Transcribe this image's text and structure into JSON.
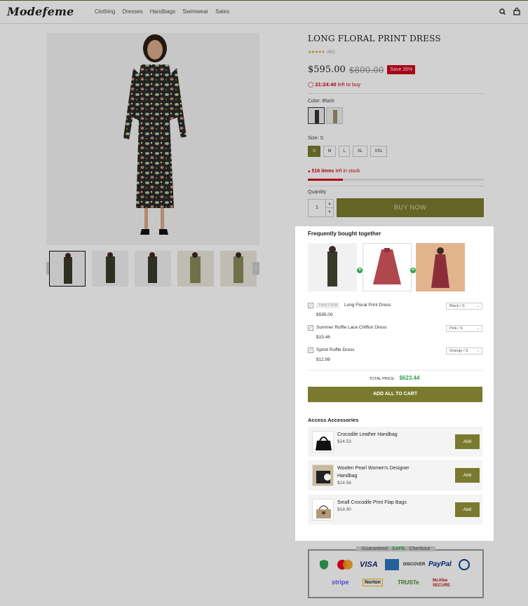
{
  "brand": {
    "logo_text": "Modefeme"
  },
  "nav": {
    "items": [
      "Clothing",
      "Dresses",
      "Handbags",
      "Swimwear",
      "Sales"
    ]
  },
  "product": {
    "title": "LONG FLORAL PRINT DRESS",
    "stars": "★★★★★",
    "review_count": "(60)",
    "price": "$595.00",
    "old_price": "$800.00",
    "save_badge": "Save 26%",
    "timer_time": "21:24:40",
    "timer_suffix": "left to buy",
    "color_label": "Color: Black",
    "size_label": "Size: S",
    "sizes": [
      "S",
      "M",
      "L",
      "XL",
      "XXL"
    ],
    "selected_size": "S",
    "stock_count": "516 items",
    "stock_suffix": "left in stock",
    "stock_fraction": 0.2,
    "quantity_label": "Quantity",
    "quantity": "1",
    "buy_label": "BUY NOW"
  },
  "fbt": {
    "title": "Frequently bought together",
    "this_item_tag": "THIS ITEM",
    "items": [
      {
        "name": "Long Floral Print Dress",
        "price": "$595.00",
        "variant": "Black / S"
      },
      {
        "name": "Summer Ruffle Lace Chiffon Dress",
        "price": "$15.46",
        "variant": "Pink / S"
      },
      {
        "name": "Sprint Ruffle Dress",
        "price": "$12.98",
        "variant": "Orange / S"
      }
    ],
    "total_label": "TOTAL PRICE:",
    "total_value": "$623.44",
    "add_all_label": "ADD ALL TO CART"
  },
  "accessories": {
    "title": "Access Accessories",
    "add_label": "Add",
    "items": [
      {
        "name": "Crocodile Leather Handbag",
        "price": "$24.53"
      },
      {
        "name": "Woolen Pearl Women's Designer Handbag",
        "price": "$14.56"
      },
      {
        "name": "Small Crocodile Print Flap Bags",
        "price": "$18.90"
      }
    ]
  },
  "checkout": {
    "title_prefix": "Guaranteed",
    "title_safe": "SAFE",
    "title_suffix": "Checkout",
    "logos": [
      "MasterCard",
      "VISA",
      "AMEX",
      "DISCOVER",
      "PayPal",
      "Diners Club",
      "stripe",
      "Norton",
      "TRUSTe",
      "McAfee SECURE"
    ]
  },
  "colors": {
    "accent": "#7a7a2e",
    "sale": "#d0021b",
    "success": "#2ea44f"
  }
}
